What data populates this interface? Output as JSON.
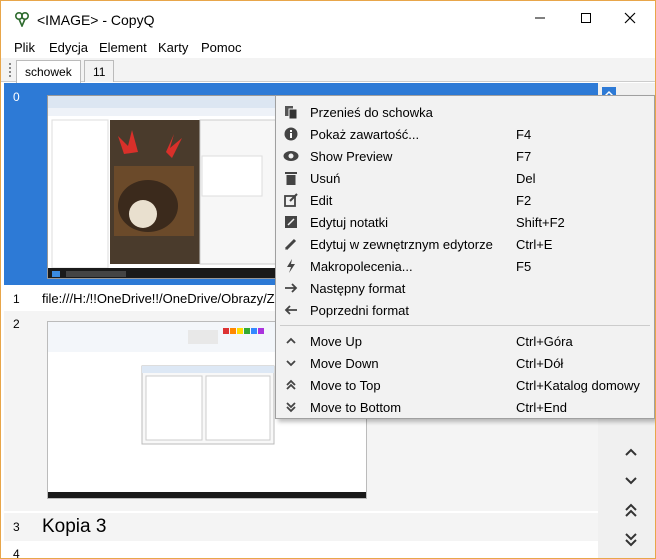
{
  "window": {
    "title": "<IMAGE> - CopyQ"
  },
  "menubar": {
    "items": [
      "Plik",
      "Edycja",
      "Element",
      "Karty",
      "Pomoc"
    ]
  },
  "tabs": [
    "schowek",
    "11"
  ],
  "items": [
    {
      "index": "0",
      "type": "image"
    },
    {
      "index": "1",
      "text": "file:///H:/!!OneDrive!!/OneDrive/Obrazy/Z aparatu/"
    },
    {
      "index": "2",
      "type": "image"
    },
    {
      "index": "3",
      "text": "Kopia 3"
    },
    {
      "index": "4",
      "text": ""
    }
  ],
  "context_menu": {
    "items": [
      {
        "icon": "paste-icon",
        "label": "Przenieś do schowka",
        "shortcut": ""
      },
      {
        "icon": "info-icon",
        "label": "Pokaż zawartość...",
        "shortcut": "F4"
      },
      {
        "icon": "eye-icon",
        "label": "Show Preview",
        "shortcut": "F7"
      },
      {
        "icon": "trash-icon",
        "label": "Usuń",
        "shortcut": "Del"
      },
      {
        "icon": "edit-icon",
        "label": "Edit",
        "shortcut": "F2"
      },
      {
        "icon": "note-icon",
        "label": "Edytuj notatki",
        "shortcut": "Shift+F2"
      },
      {
        "icon": "pencil-icon",
        "label": "Edytuj w zewnętrznym edytorze",
        "shortcut": "Ctrl+E"
      },
      {
        "icon": "bolt-icon",
        "label": "Makropolecenia...",
        "shortcut": "F5"
      },
      {
        "icon": "arrow-right-icon",
        "label": "Następny format",
        "shortcut": ""
      },
      {
        "icon": "arrow-left-icon",
        "label": "Poprzedni format",
        "shortcut": ""
      },
      {
        "icon": "chevron-up-icon",
        "label": "Move Up",
        "shortcut": "Ctrl+Góra"
      },
      {
        "icon": "chevron-down-icon",
        "label": "Move Down",
        "shortcut": "Ctrl+Dół"
      },
      {
        "icon": "double-chevron-up-icon",
        "label": "Move to Top",
        "shortcut": "Ctrl+Katalog domowy"
      },
      {
        "icon": "double-chevron-down-icon",
        "label": "Move to Bottom",
        "shortcut": "Ctrl+End"
      }
    ]
  },
  "colors": {
    "selection": "#2d7ad6",
    "accent_border": "#e8a64a"
  }
}
